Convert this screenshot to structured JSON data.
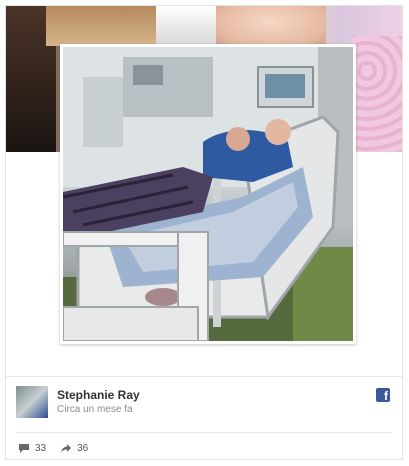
{
  "post": {
    "author_name": "Stephanie Ray",
    "time": "Circa un mese fa",
    "source_icon": "facebook-icon",
    "comments_count": "33",
    "shares_count": "36",
    "colors": {
      "facebook_blue": "#3b5998",
      "name": "#333333",
      "meta": "#8d8d8d"
    }
  }
}
